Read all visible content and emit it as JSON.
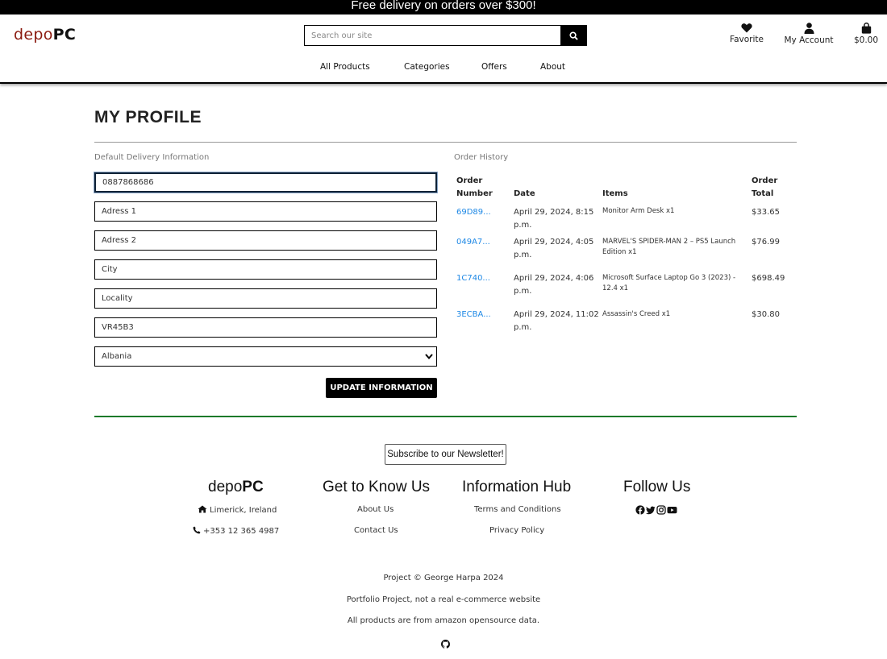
{
  "banner": {
    "text": "Free delivery on orders over $300!"
  },
  "header": {
    "logo_left": "depo",
    "logo_right": "PC",
    "search_placeholder": "Search our site",
    "icons": {
      "favorite": "Favorite",
      "account": "My Account",
      "cart": "$0.00"
    },
    "nav": [
      "All Products",
      "Categories",
      "Offers",
      "About"
    ]
  },
  "profile": {
    "title": "MY PROFILE",
    "delivery_label": "Default Delivery Information",
    "fields": {
      "phone": "0887868686",
      "address1_placeholder": "Adress 1",
      "address2_placeholder": "Adress 2",
      "city_placeholder": "City",
      "locality_placeholder": "Locality",
      "postcode": "VR45B3",
      "country": "Albania"
    },
    "update_button": "UPDATE INFORMATION"
  },
  "orders": {
    "label": "Order History",
    "headers": {
      "number": [
        "Order",
        "Number"
      ],
      "date": "Date",
      "items": "Items",
      "total": [
        "Order",
        "Total"
      ]
    },
    "rows": [
      {
        "number": "69D89...",
        "date": [
          "April 29, 2024, 8:15",
          "p.m."
        ],
        "items": [
          "Monitor Arm Desk x1"
        ],
        "total": "$33.65"
      },
      {
        "number": "049A7...",
        "date": [
          "April 29, 2024, 4:05",
          "p.m."
        ],
        "items": [
          "MARVEL'S SPIDER-MAN 2 – PS5 Launch",
          "Edition x1"
        ],
        "total": "$76.99"
      },
      {
        "number": "1C740...",
        "date": [
          "April 29, 2024, 4:06",
          "p.m."
        ],
        "items": [
          "Microsoft Surface Laptop Go 3 (2023) -",
          "12.4 x1"
        ],
        "total": "$698.49"
      },
      {
        "number": "3ECBA...",
        "date": [
          "April 29, 2024, 11:02",
          "p.m."
        ],
        "items": [
          "Assassin's Creed x1"
        ],
        "total": "$30.80"
      }
    ]
  },
  "footer": {
    "newsletter": "Subscribe to our Newsletter!",
    "brand_left": "depo",
    "brand_right": "PC",
    "location": "Limerick, Ireland",
    "phone": "+353 12 365 4987",
    "know_title": "Get to Know Us",
    "about": "About Us",
    "contact": "Contact Us",
    "info_title": "Information Hub",
    "terms": "Terms and Conditions",
    "privacy": "Privacy Policy",
    "follow_title": "Follow Us",
    "social_icons": [
      "facebook-icon",
      "twitter-icon",
      "instagram-icon",
      "youtube-icon"
    ],
    "copyright": "Project © George Harpa 2024",
    "portfolio": "Portfolio Project, not a real e-commerce website",
    "source": "All products are from amazon opensource data."
  },
  "colors": {
    "brand_red": "#8b1a0f",
    "link_blue": "#1e88e5",
    "rule_green": "#1a7a2a"
  }
}
